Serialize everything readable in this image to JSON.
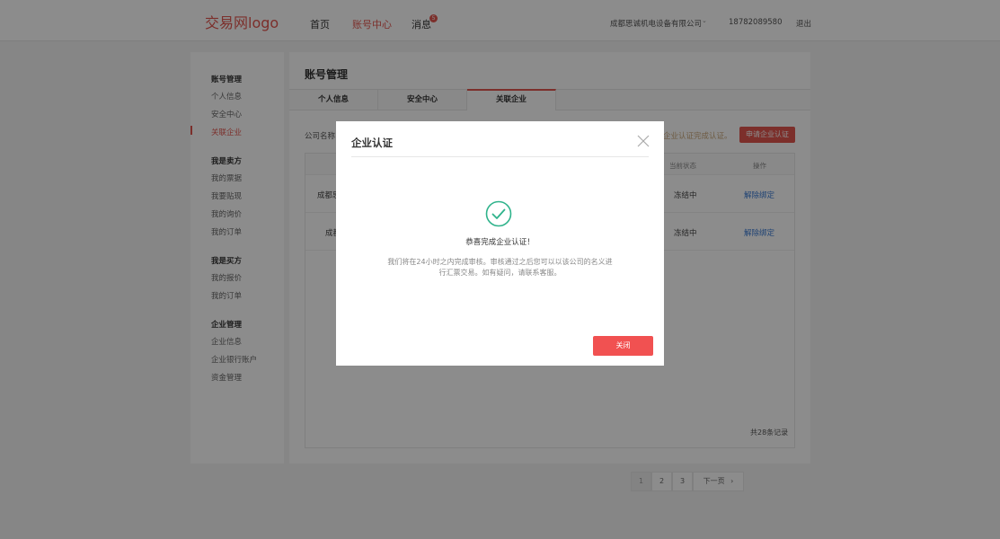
{
  "header": {
    "logo": "交易网logo",
    "nav": [
      {
        "label": "首页"
      },
      {
        "label": "账号中心"
      },
      {
        "label": "消息"
      }
    ],
    "message_badge": "5",
    "company": "成都思诚机电设备有限公司",
    "phone": "18782089580",
    "logout": "退出"
  },
  "sidebar": {
    "groups": [
      {
        "title": "账号管理",
        "items": [
          "个人信息",
          "安全中心",
          "关联企业"
        ]
      },
      {
        "title": "我是卖方",
        "items": [
          "我的票据",
          "我要贴现",
          "我的询价",
          "我的订单"
        ]
      },
      {
        "title": "我是买方",
        "items": [
          "我的报价",
          "我的订单"
        ]
      },
      {
        "title": "企业管理",
        "items": [
          "企业信息",
          "企业银行账户",
          "资金管理"
        ]
      }
    ],
    "active_item": "关联企业"
  },
  "main": {
    "title": "账号管理",
    "tabs": [
      {
        "label": "个人信息"
      },
      {
        "label": "安全中心"
      },
      {
        "label": "关联企业"
      }
    ],
    "active_tab": "关联企业",
    "filter_label": "公司名称:",
    "notice": "企业认证完成认证。",
    "apply_button": "申请企业认证",
    "table": {
      "headers": [
        "当前状态",
        "操作"
      ],
      "rows": [
        {
          "company": "成都思",
          "status": "冻结中",
          "action": "解除绑定"
        },
        {
          "company": "成都",
          "status": "冻结中",
          "action": "解除绑定"
        }
      ]
    },
    "pagination": {
      "pages": [
        "1",
        "2",
        "3"
      ],
      "current_page": "1",
      "next": "下一页",
      "next_arrow": "›",
      "total": "共28条记录"
    }
  },
  "modal": {
    "title": "企业认证",
    "close_icon": "close-icon",
    "success_icon": "check-circle-icon",
    "success_title": "恭喜完成企业认证！",
    "success_desc": "我们将在24小时之内完成审核。审核通过之后您可以以该公司的名义进行汇票交易。如有疑问，请联系客服。",
    "close_button": "关闭"
  },
  "colors": {
    "brand": "#e2564f",
    "success": "#2fb38b",
    "overlay": "rgba(0,0,0,0.45)"
  }
}
